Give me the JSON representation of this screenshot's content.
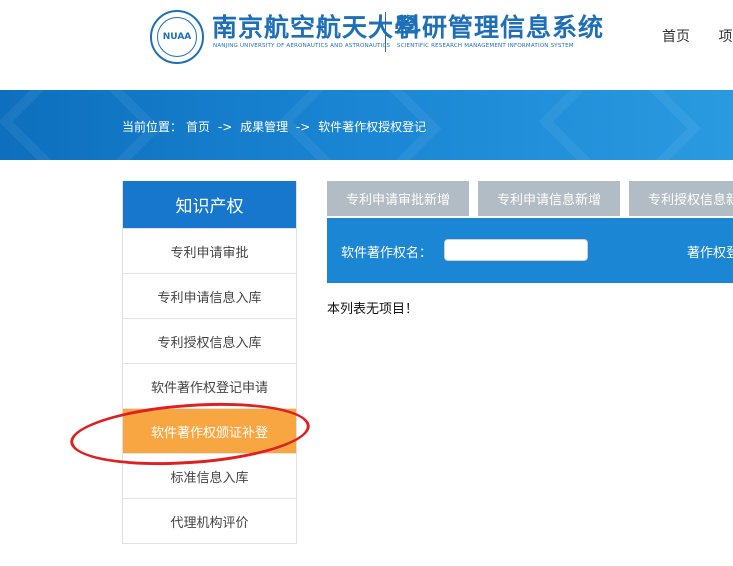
{
  "header": {
    "seal_text": "NUAA",
    "university_name": "南京航空航天大學",
    "university_en": "NANJING UNIVERSITY OF AERONAUTICS AND ASTRONAUTICS",
    "system_name": "科研管理信息系统",
    "system_en": "SCIENTIFIC RESEARCH MANAGEMENT INFORMATION SYSTEM",
    "nav": [
      "首页",
      "项"
    ]
  },
  "breadcrumb": {
    "prefix": "当前位置：",
    "items": [
      "首页",
      "成果管理",
      "软件著作权授权登记"
    ],
    "separator": "->"
  },
  "sidebar": {
    "title": "知识产权",
    "items": [
      {
        "label": "专利申请审批",
        "active": false
      },
      {
        "label": "专利申请信息入库",
        "active": false
      },
      {
        "label": "专利授权信息入库",
        "active": false
      },
      {
        "label": "软件著作权登记申请",
        "active": false
      },
      {
        "label": "软件著作权颁证补登",
        "active": true
      },
      {
        "label": "标准信息入库",
        "active": false
      },
      {
        "label": "代理机构评价",
        "active": false
      }
    ]
  },
  "tabs": [
    "专利申请审批新增",
    "专利申请信息新增",
    "专利授权信息新增"
  ],
  "search": {
    "label": "软件著作权名：",
    "value": "",
    "label2": "著作权登"
  },
  "results": {
    "empty_message": "本列表无项目！"
  },
  "colors": {
    "brand_blue": "#1677cc",
    "active_orange": "#f7a642",
    "tab_gray": "#b2bcc4",
    "annotation_red": "#e02020"
  }
}
